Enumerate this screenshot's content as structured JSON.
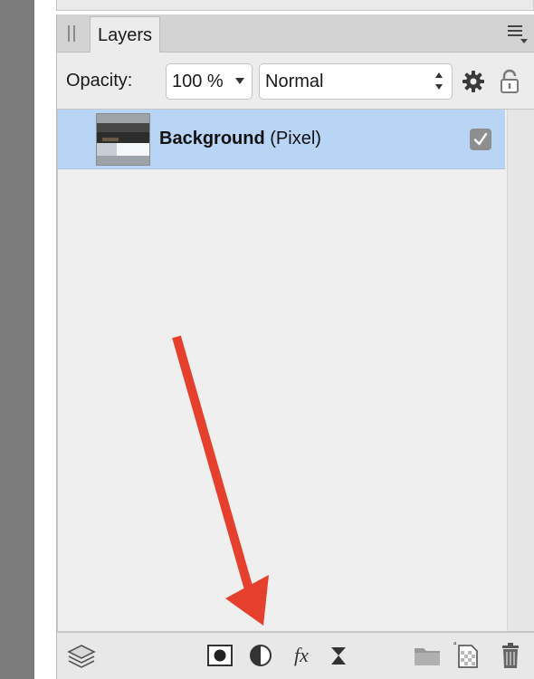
{
  "panel": {
    "tab_label": "Layers"
  },
  "toolbar": {
    "opacity_label": "Opacity:",
    "opacity_value": "100 %",
    "blend_mode": "Normal"
  },
  "layers": [
    {
      "name": "Background",
      "type": "(Pixel)",
      "visible": true,
      "selected": true
    }
  ],
  "colors": {
    "selection": "#b9d5f6",
    "annotation_arrow": "#e5402e"
  },
  "bottom_icons": [
    "layers-studio-icon",
    "mask-layer-icon",
    "adjustment-icon",
    "fx-icon",
    "live-filter-icon",
    "group-folder-icon",
    "new-pixel-layer-icon",
    "delete-icon"
  ],
  "fx_glyph": "fx"
}
